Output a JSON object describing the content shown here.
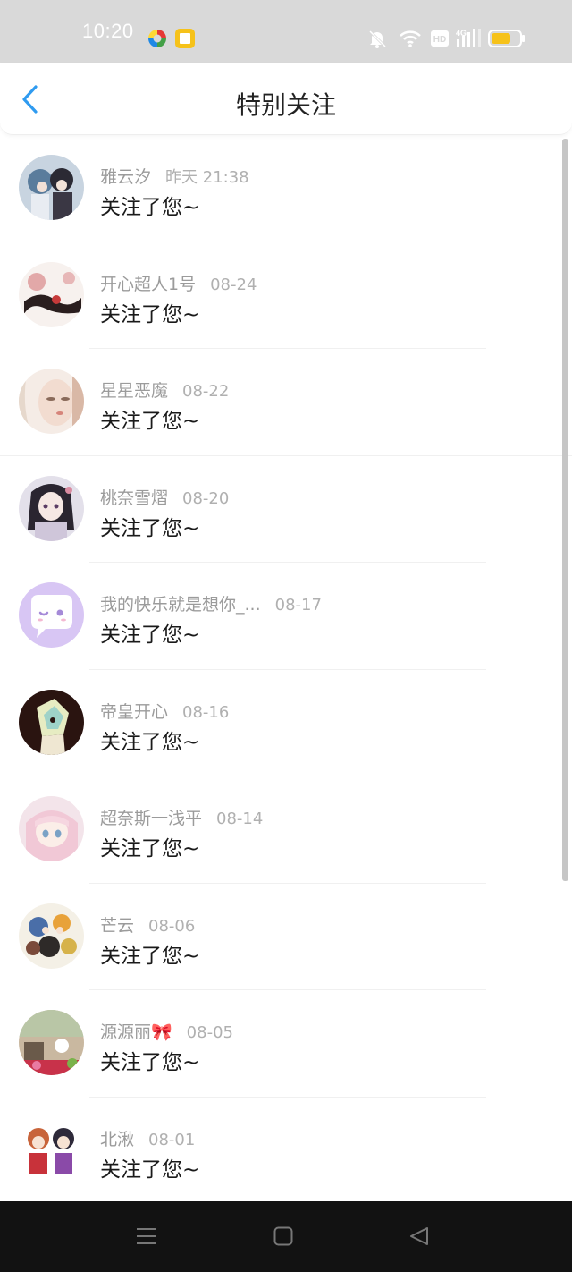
{
  "status_bar": {
    "time": "10:20"
  },
  "header": {
    "title": "特别关注"
  },
  "items": [
    {
      "name": "雅云汐",
      "date": "昨天 21:38",
      "message": "关注了您~"
    },
    {
      "name": "开心超人1号",
      "date": "08-24",
      "message": "关注了您~"
    },
    {
      "name": "星星恶魔",
      "date": "08-22",
      "message": "关注了您~"
    },
    {
      "name": "桃奈雪熠",
      "date": "08-20",
      "message": "关注了您~"
    },
    {
      "name": "我的快乐就是想你_...",
      "date": "08-17",
      "message": "关注了您~"
    },
    {
      "name": "帝皇开心",
      "date": "08-16",
      "message": "关注了您~"
    },
    {
      "name": "超奈斯一浅平",
      "date": "08-14",
      "message": "关注了您~"
    },
    {
      "name": "芒云",
      "date": "08-06",
      "message": "关注了您~"
    },
    {
      "name": "源源丽🎀",
      "date": "08-05",
      "message": "关注了您~"
    },
    {
      "name": "北湫",
      "date": "08-01",
      "message": "关注了您~"
    }
  ],
  "colors": {
    "accent": "#2f9bf0",
    "name_text": "#9b9b9b",
    "message_text": "#1a1a1a"
  }
}
